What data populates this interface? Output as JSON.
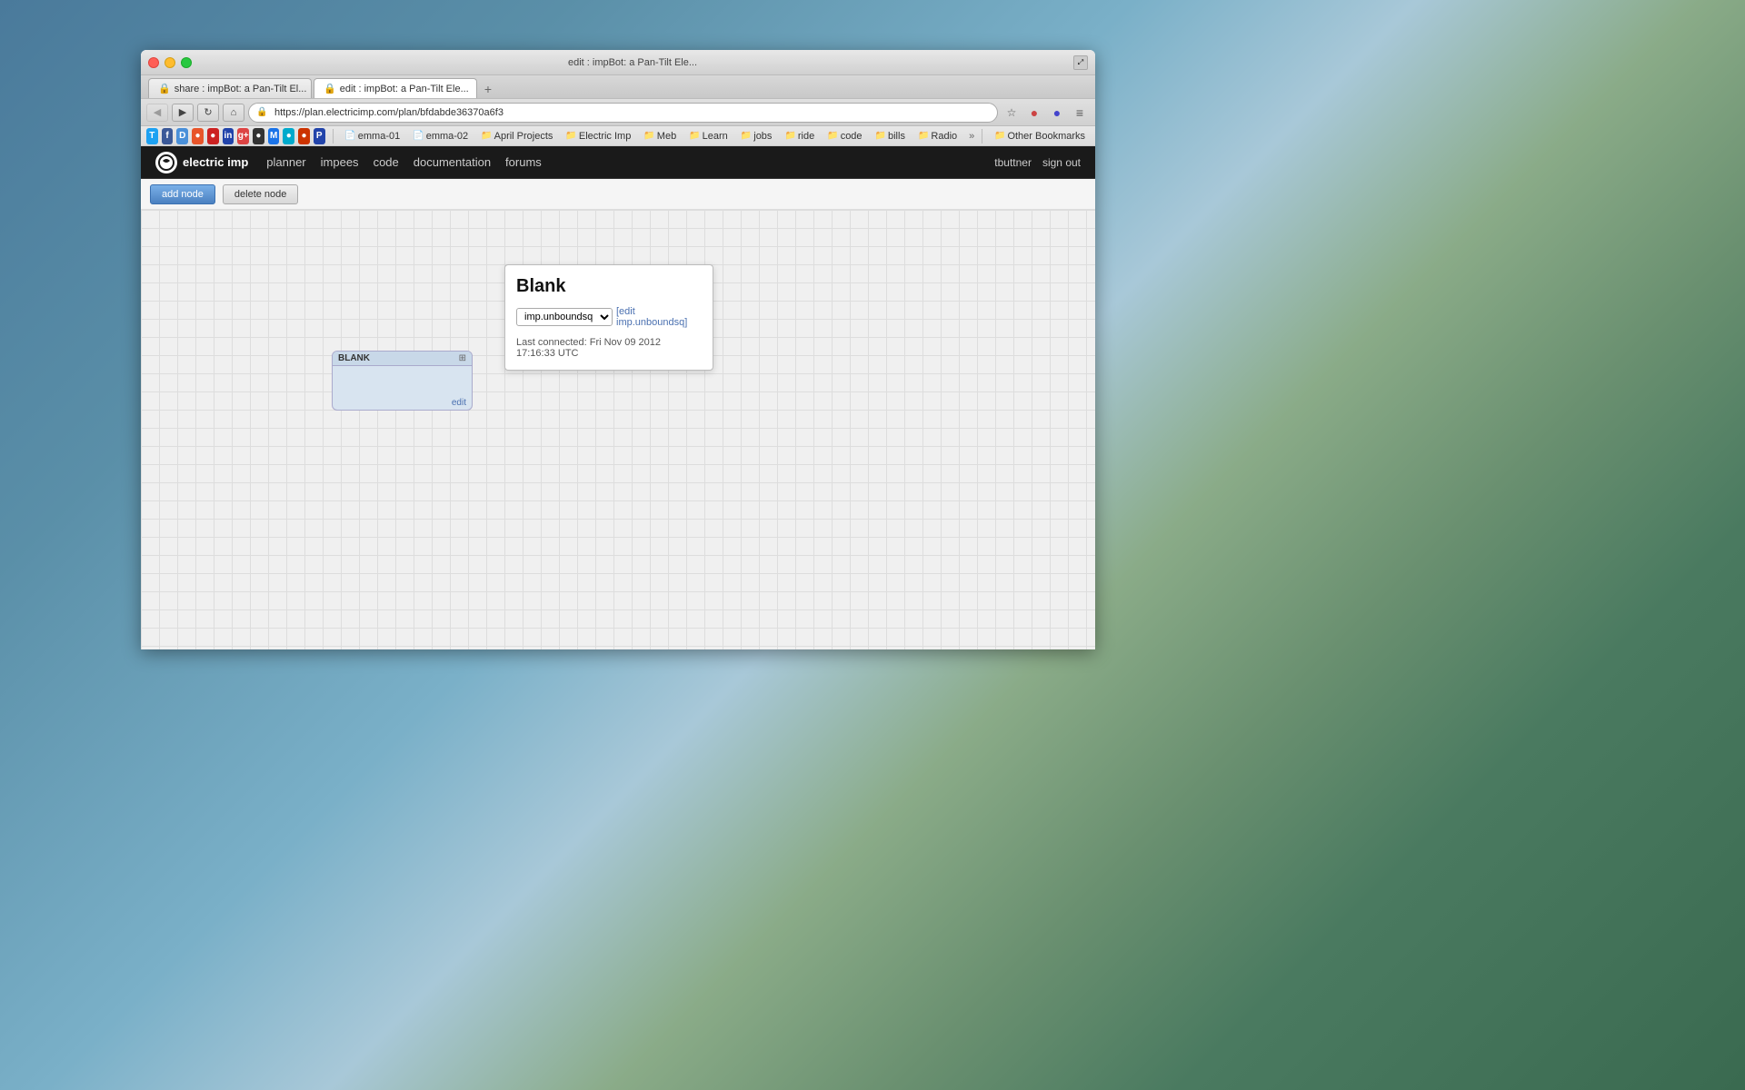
{
  "desktop": {
    "bg_description": "aerial coastal view background with blue angels planes"
  },
  "browser": {
    "title_bar": {
      "text": "edit : impBot: a Pan-Tilt Ele..."
    },
    "tabs": [
      {
        "label": "share : impBot: a Pan-Tilt El...",
        "active": false,
        "closeable": true
      },
      {
        "label": "edit : impBot: a Pan-Tilt Ele...",
        "active": true,
        "closeable": true
      }
    ],
    "address_bar": {
      "url": "https://plan.electricimp.com/plan/bfdabde36370a6f3",
      "protocol": "https://",
      "domain": "plan.electricimp.com/plan/bfdabde36370a6f3"
    },
    "nav_buttons": {
      "back": "◀",
      "forward": "▶",
      "refresh": "↻",
      "home": "⌂"
    },
    "bookmarks": [
      {
        "label": "emma-01",
        "icon": "📄",
        "type": "file"
      },
      {
        "label": "emma-02",
        "icon": "📄",
        "type": "file"
      },
      {
        "label": "April Projects",
        "icon": "📁",
        "type": "folder"
      },
      {
        "label": "Electric Imp",
        "icon": "📁",
        "type": "folder"
      },
      {
        "label": "Meb",
        "icon": "📁",
        "type": "folder"
      },
      {
        "label": "Learn",
        "icon": "📁",
        "type": "folder"
      },
      {
        "label": "jobs",
        "icon": "📁",
        "type": "folder"
      },
      {
        "label": "ride",
        "icon": "📁",
        "type": "folder"
      },
      {
        "label": "code",
        "icon": "📁",
        "type": "folder"
      },
      {
        "label": "bills",
        "icon": "📁",
        "type": "folder"
      },
      {
        "label": "Radio",
        "icon": "📁",
        "type": "folder"
      },
      {
        "label": "Other Bookmarks",
        "icon": "📁",
        "type": "folder"
      }
    ]
  },
  "app_nav": {
    "logo_text": "electric imp",
    "links": [
      {
        "label": "planner"
      },
      {
        "label": "impees"
      },
      {
        "label": "code"
      },
      {
        "label": "documentation"
      },
      {
        "label": "forums"
      }
    ],
    "user": "tbuttner",
    "signout": "sign out"
  },
  "toolbar": {
    "add_node_label": "add node",
    "delete_node_label": "delete node"
  },
  "node_card": {
    "title": "BLANK",
    "edit_label": "edit"
  },
  "popup": {
    "title": "Blank",
    "select_value": "imp.unboundsq",
    "edit_link_label": "[edit imp.unboundsq]",
    "status": "Last connected: Fri Nov 09 2012 17:16:33 UTC"
  }
}
